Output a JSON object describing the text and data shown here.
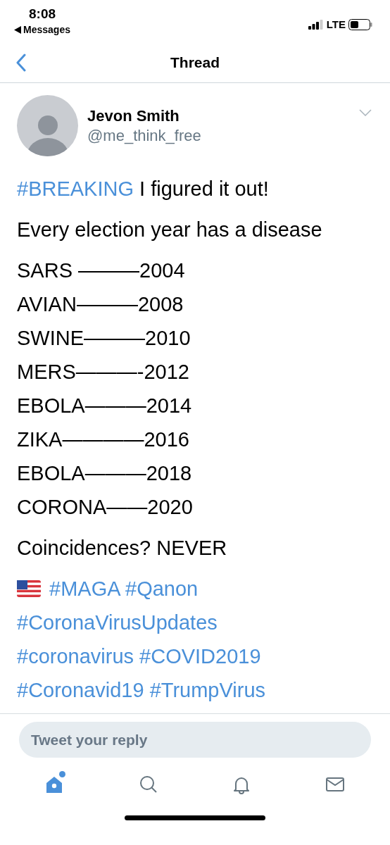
{
  "status_bar": {
    "time": "8:08",
    "back_app": "Messages",
    "network": "LTE"
  },
  "header": {
    "title": "Thread"
  },
  "tweet": {
    "author": {
      "name": "Jevon Smith",
      "handle": "@me_think_free"
    },
    "blocks": [
      {
        "kind": "paragraph",
        "lines": [
          [
            {
              "kind": "hashtag",
              "text": "#BREAKING"
            },
            {
              "kind": "text",
              "text": " I figured it out!"
            }
          ]
        ]
      },
      {
        "kind": "paragraph",
        "lines": [
          [
            {
              "kind": "text",
              "text": "Every election year has a disease"
            }
          ]
        ]
      },
      {
        "kind": "paragraph",
        "lines": [
          [
            {
              "kind": "text",
              "text": "SARS ———2004"
            }
          ],
          [
            {
              "kind": "text",
              "text": "AVIAN———2008"
            }
          ],
          [
            {
              "kind": "text",
              "text": "SWINE———2010"
            }
          ],
          [
            {
              "kind": "text",
              "text": "MERS———-2012"
            }
          ],
          [
            {
              "kind": "text",
              "text": "EBOLA———2014"
            }
          ],
          [
            {
              "kind": "text",
              "text": "ZIKA————2016"
            }
          ],
          [
            {
              "kind": "text",
              "text": "EBOLA———2018"
            }
          ],
          [
            {
              "kind": "text",
              "text": "CORONA——2020"
            }
          ]
        ]
      },
      {
        "kind": "paragraph",
        "lines": [
          [
            {
              "kind": "text",
              "text": "Coincidences? NEVER"
            }
          ]
        ]
      },
      {
        "kind": "paragraph",
        "lines": [
          [
            {
              "kind": "flag"
            },
            {
              "kind": "hashtag",
              "text": "#MAGA"
            },
            {
              "kind": "hashtag",
              "text": "#Qanon"
            }
          ],
          [
            {
              "kind": "hashtag",
              "text": "#CoronaVirusUpdates"
            }
          ],
          [
            {
              "kind": "hashtag",
              "text": "#coronavirus"
            },
            {
              "kind": "hashtag",
              "text": "#COVID2019"
            }
          ],
          [
            {
              "kind": "hashtag",
              "text": "#Coronavid19"
            },
            {
              "kind": "hashtag",
              "text": "#TrumpVirus"
            }
          ]
        ]
      }
    ]
  },
  "reply": {
    "placeholder": "Tweet your reply"
  },
  "tab_bar": [
    {
      "kind": "home",
      "selected": true,
      "dot": true
    },
    {
      "kind": "search",
      "selected": false,
      "dot": false
    },
    {
      "kind": "bell",
      "selected": false,
      "dot": false
    },
    {
      "kind": "mail",
      "selected": false,
      "dot": false
    }
  ]
}
